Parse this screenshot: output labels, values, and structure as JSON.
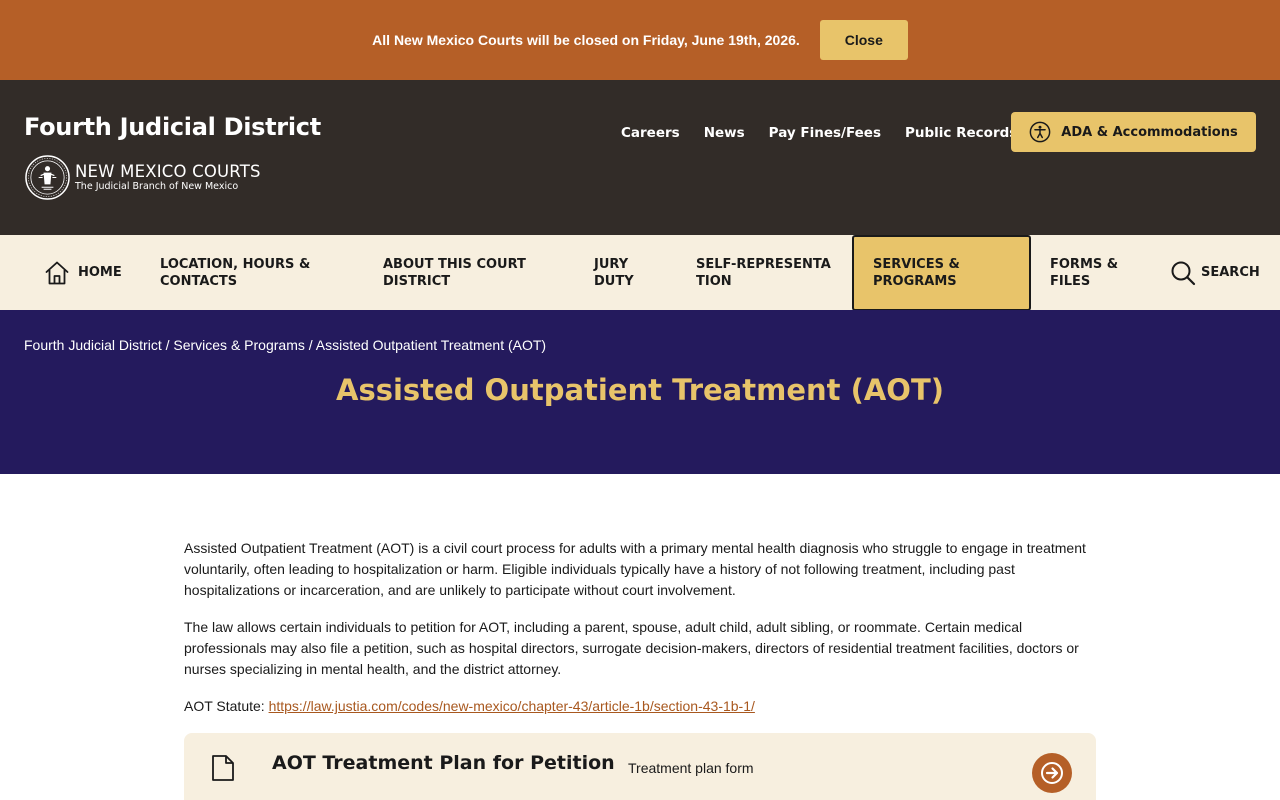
{
  "alert": {
    "text": "All New Mexico Courts will be closed on Friday, June 19th, 2026.",
    "close_label": "Close"
  },
  "header": {
    "site_title": "Fourth Judicial District",
    "logo_title": "NEW MEXICO COURTS",
    "logo_subtitle": "The Judicial Branch of New Mexico",
    "util_links": [
      "Careers",
      "News",
      "Pay Fines/Fees",
      "Public Records"
    ],
    "ada_label": "ADA & Accommodations"
  },
  "nav": {
    "home": "HOME",
    "location": "LOCATION, HOURS & CONTACTS",
    "about": "ABOUT THIS COURT DISTRICT",
    "jury": "JURY DUTY",
    "self_rep": "SELF-REPRESENTATION",
    "services": "SERVICES & PROGRAMS",
    "forms": "FORMS & FILES",
    "search": "SEARCH"
  },
  "hero": {
    "breadcrumb": [
      "Fourth Judicial District",
      "Services & Programs",
      "Assisted Outpatient Treatment (AOT)"
    ],
    "breadcrumb_sep": " / ",
    "title": "Assisted Outpatient Treatment (AOT)"
  },
  "content": {
    "p1": "Assisted Outpatient Treatment (AOT) is a civil court process for adults with a primary mental health diagnosis who struggle to engage in treatment voluntarily, often leading to hospitalization or harm. Eligible individuals typically have a history of not following treatment, including past hospitalizations or incarceration, and are unlikely to participate without court involvement.",
    "p2": "The law allows certain individuals to petition for AOT, including a parent, spouse, adult child, adult sibling, or roommate. Certain medical professionals may also file a petition, such as hospital directors, surrogate decision-makers, directors of residential treatment facilities, doctors or nurses specializing in mental health, and the district attorney.",
    "statute_label": "AOT Statute: ",
    "statute_url": "https://law.justia.com/codes/new-mexico/chapter-43/article-1b/section-43-1b-1/"
  },
  "card": {
    "title": "AOT Treatment Plan for Petition",
    "description": "Treatment plan form",
    "icon": "document-icon",
    "action_icon": "arrow-right-icon"
  },
  "colors": {
    "alert_bg": "#b55f27",
    "header_bg": "#322c28",
    "accent_gold": "#e8c46a",
    "nav_bg": "#f7efdf",
    "hero_bg": "#241a5d",
    "link": "#a8581f"
  }
}
